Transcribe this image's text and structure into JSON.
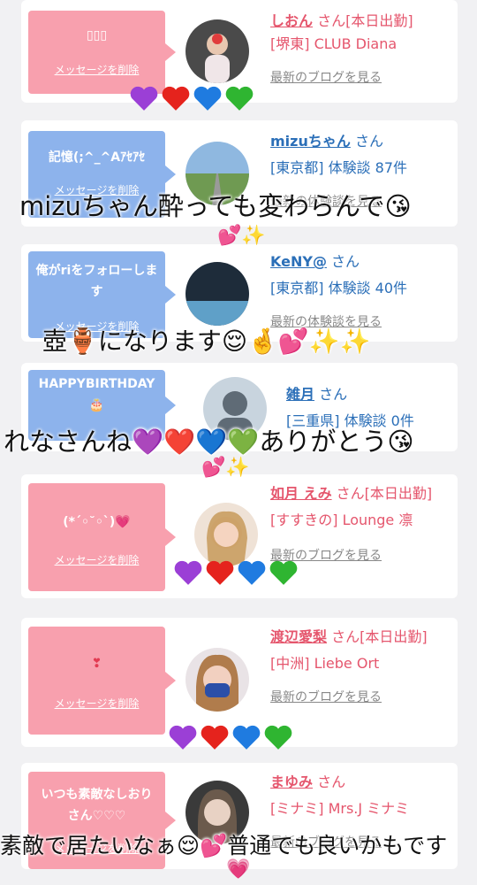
{
  "delete_label": "メッセージを削除",
  "san": "さん",
  "cards": [
    {
      "message": "▯▯▯",
      "name": "しおん",
      "suffix": "さん[本日出勤]",
      "shop": "[堺東] CLUB Diana",
      "link": "最新のブログを見る"
    },
    {
      "message": "記憶(;^_^Aｱｾｱｾ",
      "name": "mizuちゃん",
      "suffix": "さん",
      "shop": "[東京都] 体験談 87件",
      "link": "最新の体験談を見る"
    },
    {
      "message": "俺がriをフォローします",
      "name": "KeNY@",
      "suffix": "さん",
      "shop": "[東京都] 体験談 40件",
      "link": "最新の体験談を見る"
    },
    {
      "message": "HAPPYBIRTHDAY 🎂",
      "name": "雑月",
      "suffix": "さん",
      "shop": "[三重県] 体験談 0件",
      "link": ""
    },
    {
      "message": "(*´◦˘◦`)💗",
      "name": "如月 えみ",
      "suffix": "さん[本日出勤]",
      "shop": "[すすきの] Lounge 凛",
      "link": "最新のブログを見る"
    },
    {
      "message": "❣",
      "name": "渡辺愛梨",
      "suffix": "さん[本日出勤]",
      "shop": "[中洲] Liebe Ort",
      "link": "最新のブログを見る"
    },
    {
      "message": "いつも素敵なしおりさん♡♡♡",
      "name": "まゆみ",
      "suffix": "さん",
      "shop": "[ミナミ] Mrs.J ミナミ",
      "link": "最新のブログを見る"
    }
  ],
  "overlays": {
    "t1": "mizuちゃん酔っても変わらんで😘",
    "t2": "壺🏺になります😌🤞💕✨✨",
    "t3": "れなさんね💜❤️💙💚ありがとう😘",
    "t4": "素敵で居たいなぁ😌💕普通でも良いかもです",
    "s1": "💕✨",
    "s2": "💕✨",
    "s3": "💗"
  },
  "colors": {
    "pink": "#f8a0ae",
    "blue": "#8db3ec",
    "name_pink": "#e5566d",
    "name_blue": "#2b6fb8"
  }
}
